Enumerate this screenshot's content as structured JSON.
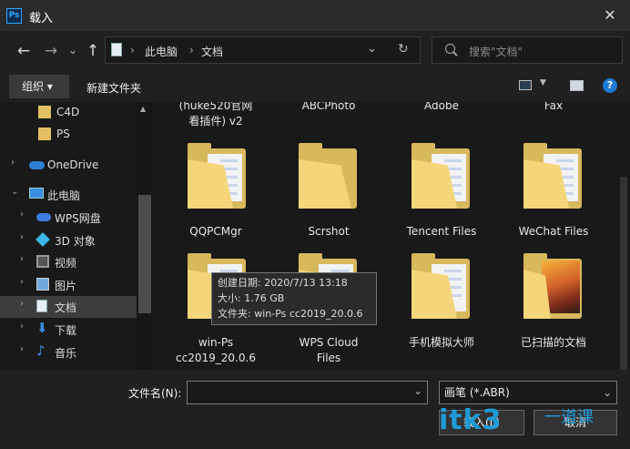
{
  "window": {
    "icon_text": "Ps",
    "title": "载入",
    "close": "✕"
  },
  "nav": {
    "back": "←",
    "forward": "→",
    "recent": "⌄",
    "up": "↑"
  },
  "address": {
    "sep1": "›",
    "crumbs": [
      "此电脑",
      "文档"
    ],
    "sep2": "›",
    "dropdown": "⌄",
    "refresh": "↻"
  },
  "search": {
    "placeholder": "搜索\"文档\""
  },
  "toolbar": {
    "organize": "组织 ▾",
    "new_folder": "新建文件夹",
    "help": "?"
  },
  "sidebar": {
    "items": [
      {
        "label": "C4D"
      },
      {
        "label": "PS"
      },
      {
        "label": "OneDrive"
      },
      {
        "label": "此电脑"
      },
      {
        "label": "WPS网盘"
      },
      {
        "label": "3D 对象"
      },
      {
        "label": "视频"
      },
      {
        "label": "图片"
      },
      {
        "label": "文档"
      },
      {
        "label": "下载"
      },
      {
        "label": "音乐"
      }
    ]
  },
  "files": {
    "top_row": [
      {
        "line1": "(huke520官网",
        "line2": "看插件) v2"
      },
      {
        "line1": "ABCPhoto"
      },
      {
        "line1": "Adobe"
      },
      {
        "line1": "Fax"
      }
    ],
    "row2": [
      {
        "line1": "QQPCMgr"
      },
      {
        "line1": "Scrshot"
      },
      {
        "line1": "Tencent Files"
      },
      {
        "line1": "WeChat Files"
      }
    ],
    "row3": [
      {
        "line1": "win-Ps",
        "line2": "cc2019_20.0.6"
      },
      {
        "line1": "WPS Cloud",
        "line2": "Files"
      },
      {
        "line1": "手机模拟大师"
      },
      {
        "line1": "已扫描的文档"
      }
    ]
  },
  "tooltip": {
    "created": "创建日期: 2020/7/13 13:18",
    "size": "大小: 1.76 GB",
    "folders": "文件夹: win-Ps cc2019_20.0.6"
  },
  "bottom": {
    "filename_label": "文件名(N):",
    "filename_value": "",
    "filetype": "画笔 (*.ABR)",
    "load_button": "载入(L)",
    "cancel_button": "取消"
  },
  "watermark": {
    "text": "itk3",
    "cn": "一道课"
  },
  "colors": {
    "folder": "#d8b85c",
    "accent": "#1e9bd7"
  }
}
